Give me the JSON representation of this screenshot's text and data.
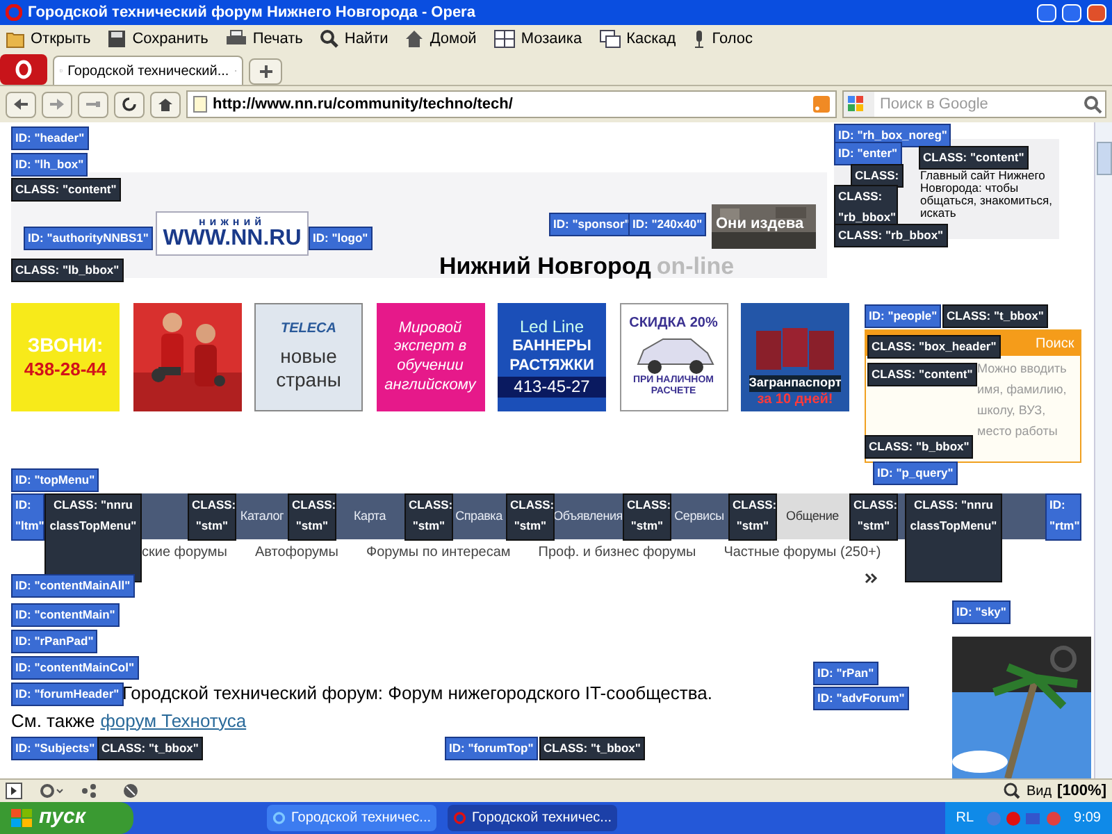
{
  "window": {
    "title": "Городской технический форум Нижнего Новгорода - Opera"
  },
  "toolbar": [
    {
      "kind": "open",
      "label": "Открыть"
    },
    {
      "kind": "save",
      "label": "Сохранить"
    },
    {
      "kind": "print",
      "label": "Печать"
    },
    {
      "kind": "find",
      "label": "Найти"
    },
    {
      "kind": "home",
      "label": "Домой"
    },
    {
      "kind": "tile",
      "label": "Мозаика"
    },
    {
      "kind": "cascade",
      "label": "Каскад"
    },
    {
      "kind": "voice",
      "label": "Голос"
    }
  ],
  "tabs": [
    {
      "label": "Городской технический...",
      "selected": true
    }
  ],
  "address": {
    "url": "http://www.nn.ru/community/techno/tech/"
  },
  "search": {
    "placeholder": "Поиск в Google"
  },
  "header": {
    "logo_small": "нижний",
    "logo": "WWW.NN.RU",
    "site_title": "Нижний Новгород",
    "site_suffix": "on-line",
    "sponsor_text": "Они издева",
    "intro": "Главный сайт Нижнего Новгорода: чтобы общаться, знакомиться, искать"
  },
  "banners": [
    {
      "kind": "call",
      "lines": [
        "ЗВОНИ:",
        "438-28-44"
      ]
    },
    {
      "kind": "picture"
    },
    {
      "kind": "teleca",
      "lines": [
        "TELECA",
        "новые страны"
      ]
    },
    {
      "kind": "english",
      "lines": [
        "Мировой эксперт в обучении английскому"
      ]
    },
    {
      "kind": "led",
      "lines": [
        "Led Line",
        "БАННЕРЫ РАСТЯЖКИ",
        "413-45-27"
      ]
    },
    {
      "kind": "car",
      "lines": [
        "СКИДКА 20%",
        "ПРИ НАЛИЧНОМ РАСЧЕТЕ"
      ]
    },
    {
      "kind": "passport",
      "lines": [
        "Загранпаспорт",
        "за 10 дней!"
      ]
    }
  ],
  "people": {
    "header": "Поиск",
    "hint": "Можно вводить имя, фамилию, школу, ВУЗ, место работы"
  },
  "menu": [
    {
      "label": "Каталог",
      "selected": false
    },
    {
      "label": "Карта",
      "selected": false
    },
    {
      "label": "Справка",
      "selected": false
    },
    {
      "label": "Объявления",
      "selected": false
    },
    {
      "label": "Сервисы",
      "selected": false
    },
    {
      "label": "Общение",
      "selected": true
    }
  ],
  "submenu": [
    "ские форумы",
    "Автофорумы",
    "Форумы по интересам",
    "Проф. и бизнес форумы",
    "Частные форумы (250+)"
  ],
  "forum": {
    "heading": "Городской технический форум: Форум нижегородского IT-сообщества.",
    "see_also": "См. также",
    "link": "форум Технотуса"
  },
  "debug_tags": [
    {
      "kind": "id",
      "text": "ID: \"header\""
    },
    {
      "kind": "id",
      "text": "ID: \"lh_box\""
    },
    {
      "kind": "class",
      "text": "CLASS: \"content\""
    },
    {
      "kind": "id",
      "text": "ID: \"authorityNNBS1\""
    },
    {
      "kind": "id",
      "text": "ID: \"logo\""
    },
    {
      "kind": "id",
      "text": "ID: \"sponsor\""
    },
    {
      "kind": "id",
      "text": "ID: \"240x40\""
    },
    {
      "kind": "class",
      "text": "CLASS: \"lb_bbox\""
    },
    {
      "kind": "id",
      "text": "ID: \"rh_box_noreg\""
    },
    {
      "kind": "id",
      "text": "ID: \"enter\""
    },
    {
      "kind": "class",
      "text": "CLASS: \"content\""
    },
    {
      "kind": "class",
      "text": "CLASS:"
    },
    {
      "kind": "class",
      "text": "CLASS: \"rb_bbox\""
    },
    {
      "kind": "class",
      "text": "CLASS: \"rb_bbox\""
    },
    {
      "kind": "id",
      "text": "ID: \"people\""
    },
    {
      "kind": "class",
      "text": "CLASS: \"t_bbox\""
    },
    {
      "kind": "class",
      "text": "CLASS: \"box_header\""
    },
    {
      "kind": "class",
      "text": "CLASS: \"content\""
    },
    {
      "kind": "class",
      "text": "CLASS: \"b_bbox\""
    },
    {
      "kind": "id",
      "text": "ID: \"p_query\""
    },
    {
      "kind": "id",
      "text": "ID: \"topMenu\""
    },
    {
      "kind": "id",
      "text": "ID: \"ltm\""
    },
    {
      "kind": "class",
      "text": "CLASS: \"nnru classTopMenu\""
    },
    {
      "kind": "class",
      "text": "CLASS: \"stm\""
    },
    {
      "kind": "class",
      "text": "CLASS: \"stm\""
    },
    {
      "kind": "class",
      "text": "CLASS: \"stm\""
    },
    {
      "kind": "class",
      "text": "CLASS: \"stm\""
    },
    {
      "kind": "class",
      "text": "CLASS: \"stm\""
    },
    {
      "kind": "class",
      "text": "CLASS: \"stm\""
    },
    {
      "kind": "class",
      "text": "CLASS: \"stm\""
    },
    {
      "kind": "class",
      "text": "CLASS: \"nnru classTopMenu\""
    },
    {
      "kind": "id",
      "text": "ID: \"rtm\""
    },
    {
      "kind": "id",
      "text": "ID: \"contentMainAll\""
    },
    {
      "kind": "id",
      "text": "ID: \"contentMain\""
    },
    {
      "kind": "id",
      "text": "ID: \"rPanPad\""
    },
    {
      "kind": "id",
      "text": "ID: \"contentMainCol\""
    },
    {
      "kind": "id",
      "text": "ID: \"forumHeader\""
    },
    {
      "kind": "id",
      "text": "ID: \"sky\""
    },
    {
      "kind": "id",
      "text": "ID: \"rPan\""
    },
    {
      "kind": "id",
      "text": "ID: \"advForum\""
    },
    {
      "kind": "id",
      "text": "ID: \"Subjects\""
    },
    {
      "kind": "class",
      "text": "CLASS: \"t_bbox\""
    },
    {
      "kind": "id",
      "text": "ID: \"forumTop\""
    },
    {
      "kind": "class",
      "text": "CLASS: \"t_bbox\""
    }
  ],
  "status_bar": {
    "view": "Вид",
    "zoom": "[100%]"
  },
  "taskbar": {
    "start": "пуск",
    "tasks": [
      {
        "label": "Городской техничес...",
        "selected": false
      },
      {
        "label": "Городской техничес...",
        "selected": true
      }
    ],
    "lang": "RL",
    "time": "9:09"
  }
}
